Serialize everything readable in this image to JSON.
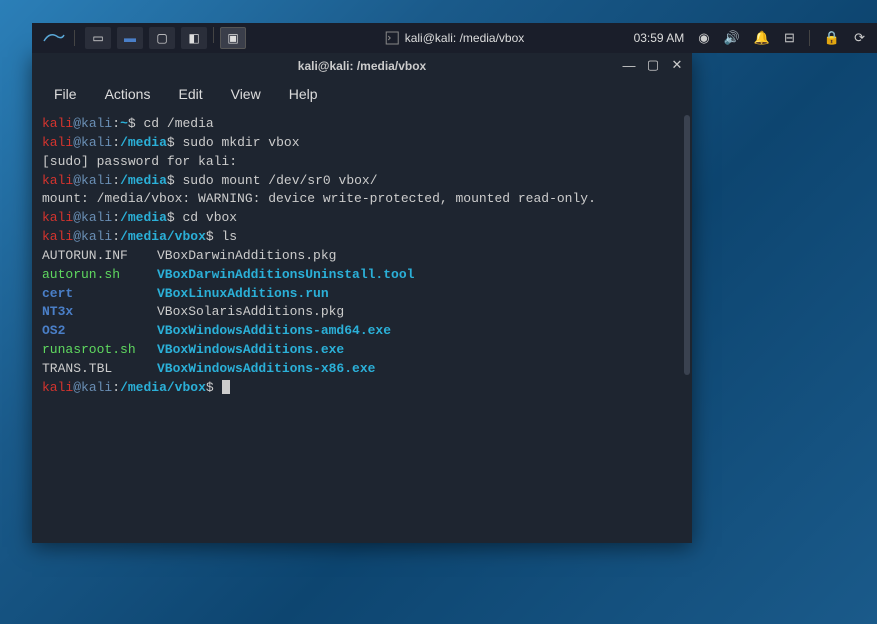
{
  "topbar": {
    "window_title": "kali@kali: /media/vbox",
    "clock": "03:59 AM"
  },
  "terminal": {
    "title": "kali@kali: /media/vbox",
    "menu": {
      "file": "File",
      "actions": "Actions",
      "edit": "Edit",
      "view": "View",
      "help": "Help"
    },
    "prompts": {
      "user": "kali",
      "at": "@",
      "host": "kali",
      "home_path": "~",
      "media_path": "/media",
      "vbox_path": "/media/vbox",
      "dollar": "$"
    },
    "lines": {
      "cmd1": " cd /media",
      "cmd2": " sudo mkdir vbox",
      "sudo_prompt": "[sudo] password for kali:",
      "cmd3": " sudo mount /dev/sr0 vbox/",
      "mount_warn": "mount: /media/vbox: WARNING: device write-protected, mounted read-only.",
      "cmd4": " cd vbox",
      "cmd5": " ls"
    },
    "ls": {
      "r1c1": "AUTORUN.INF",
      "r1c2": "VBoxDarwinAdditions.pkg",
      "r2c1": "autorun.sh",
      "r2c2": "VBoxDarwinAdditionsUninstall.tool",
      "r3c1": "cert",
      "r3c2": "VBoxLinuxAdditions.run",
      "r4c1": "NT3x",
      "r4c2": "VBoxSolarisAdditions.pkg",
      "r5c1": "OS2",
      "r5c2": "VBoxWindowsAdditions-amd64.exe",
      "r6c1": "runasroot.sh",
      "r6c2": "VBoxWindowsAdditions.exe",
      "r7c1": "TRANS.TBL",
      "r7c2": "VBoxWindowsAdditions-x86.exe"
    }
  }
}
